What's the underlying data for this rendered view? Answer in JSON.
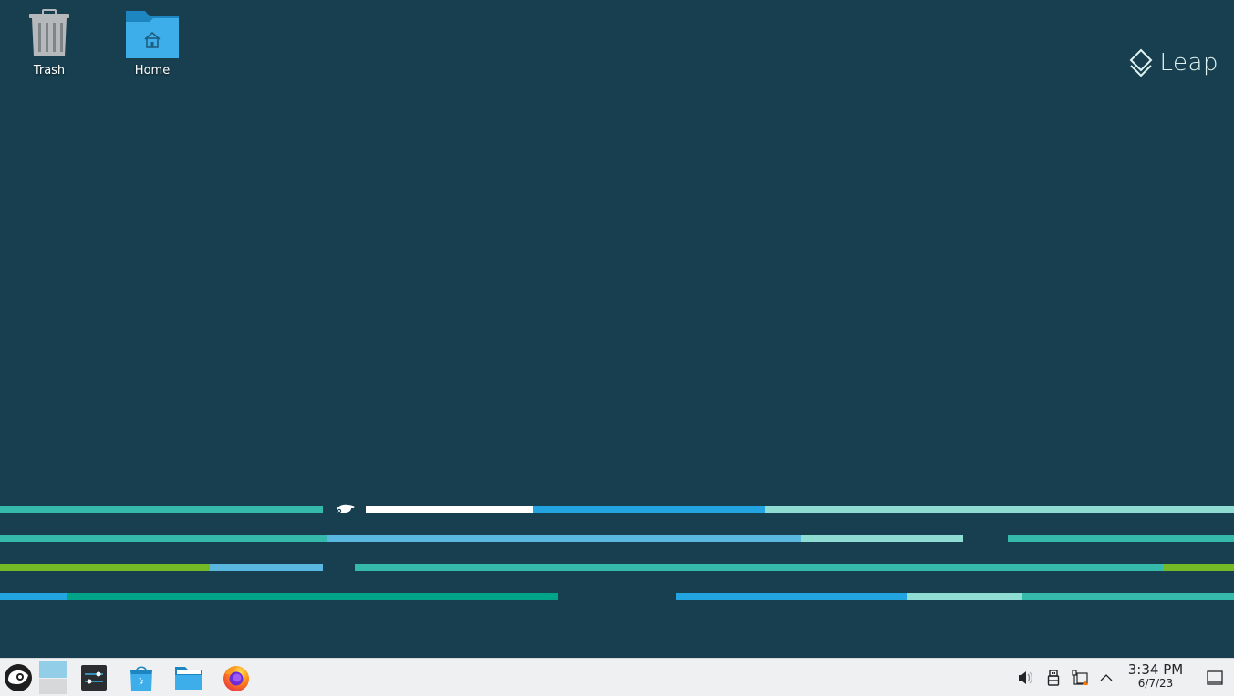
{
  "desktop": {
    "icons": [
      {
        "label": "Trash",
        "icon": "trash-icon"
      },
      {
        "label": "Home",
        "icon": "home-folder-icon"
      }
    ],
    "branding": {
      "text": "Leap",
      "icon": "leap-diamond-icon"
    },
    "wallpaper": {
      "background_color": "#173f4f",
      "stripe_colors": {
        "teal": "#35b9ab",
        "blue": "#21a4df",
        "light_blue": "#5ab8e0",
        "mint": "#8fdcd2",
        "green": "#73ba25",
        "white": "#ffffff",
        "dark_teal": "#00a489"
      },
      "logo_icon": "opensuse-chameleon-icon"
    }
  },
  "taskbar": {
    "launcher_icon": "opensuse-launcher-icon",
    "pager_icon": "virtual-desktop-pager-icon",
    "tasks": [
      {
        "name": "System Settings",
        "icon": "system-settings-icon"
      },
      {
        "name": "Discover",
        "icon": "discover-store-icon"
      },
      {
        "name": "Dolphin",
        "icon": "file-manager-icon"
      },
      {
        "name": "Firefox",
        "icon": "firefox-icon"
      }
    ],
    "tray": [
      {
        "name": "Volume",
        "icon": "volume-icon"
      },
      {
        "name": "Removable devices",
        "icon": "usb-device-icon"
      },
      {
        "name": "Network",
        "icon": "network-icon"
      },
      {
        "name": "Show hidden icons",
        "icon": "chevron-up-icon"
      }
    ],
    "clock": {
      "time": "3:34 PM",
      "date": "6/7/23"
    },
    "show_desktop_icon": "show-desktop-icon"
  }
}
